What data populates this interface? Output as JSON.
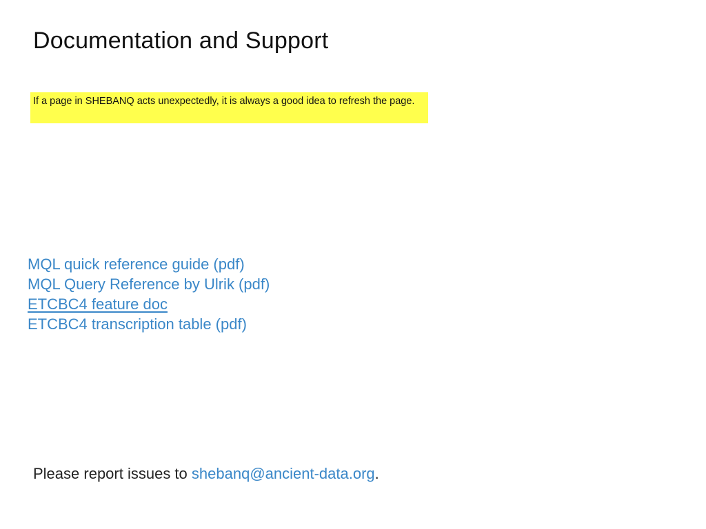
{
  "page": {
    "title": "Documentation and Support"
  },
  "notice": {
    "text": "If a page in SHEBANQ acts unexpectedly, it is always a good idea to refresh the page.",
    "background_color": "#ffff4d"
  },
  "links": [
    {
      "label": "MQL quick reference guide (pdf)",
      "underlined": false
    },
    {
      "label": "MQL Query Reference by Ulrik (pdf)",
      "underlined": false
    },
    {
      "label": "ETCBC4 feature doc",
      "underlined": true
    },
    {
      "label": "ETCBC4 transcription table (pdf)",
      "underlined": false
    }
  ],
  "footer": {
    "prefix": "Please report issues to ",
    "email": "shebanq@ancient-data.org",
    "suffix": "."
  },
  "colors": {
    "link": "#3a87c8",
    "text": "#222222"
  }
}
